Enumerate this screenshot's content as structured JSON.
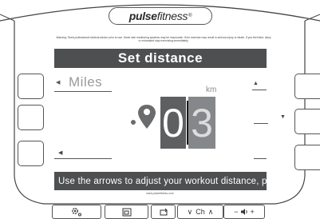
{
  "brand": {
    "name_bold": "pulse",
    "name_light": "fitness",
    "trademark": "®"
  },
  "warning_text": "Warning: Seek professional medical advice prior to use. Heart rate monitoring systems may be inaccurate. Over exercise may result in serious injury or death. If you feel faint, dizzy or exhausted stop exercising immediately.",
  "screen": {
    "title": "Set distance",
    "unit_option": "Miles",
    "unit_secondary": "km",
    "digits": [
      "0",
      "3"
    ],
    "marquee": "Use the arrows to adjust your workout distance, pre"
  },
  "footer_url": "www.pulsefitness.com",
  "bottom_buttons": {
    "channel_label": "Ch",
    "chevron_down": "∨",
    "chevron_up": "∧",
    "minus": "−",
    "plus": "+"
  },
  "icons": {
    "settings": "settings-icon",
    "window": "window-icon",
    "repeat": "repeat-icon",
    "volume": "volume-icon",
    "map_pin": "map-pin-icon"
  },
  "colors": {
    "title_bar": "#4e4f51",
    "digit_primary": "#5e5f61",
    "digit_secondary": "#85878a",
    "unit_text": "#9a9a9a"
  }
}
